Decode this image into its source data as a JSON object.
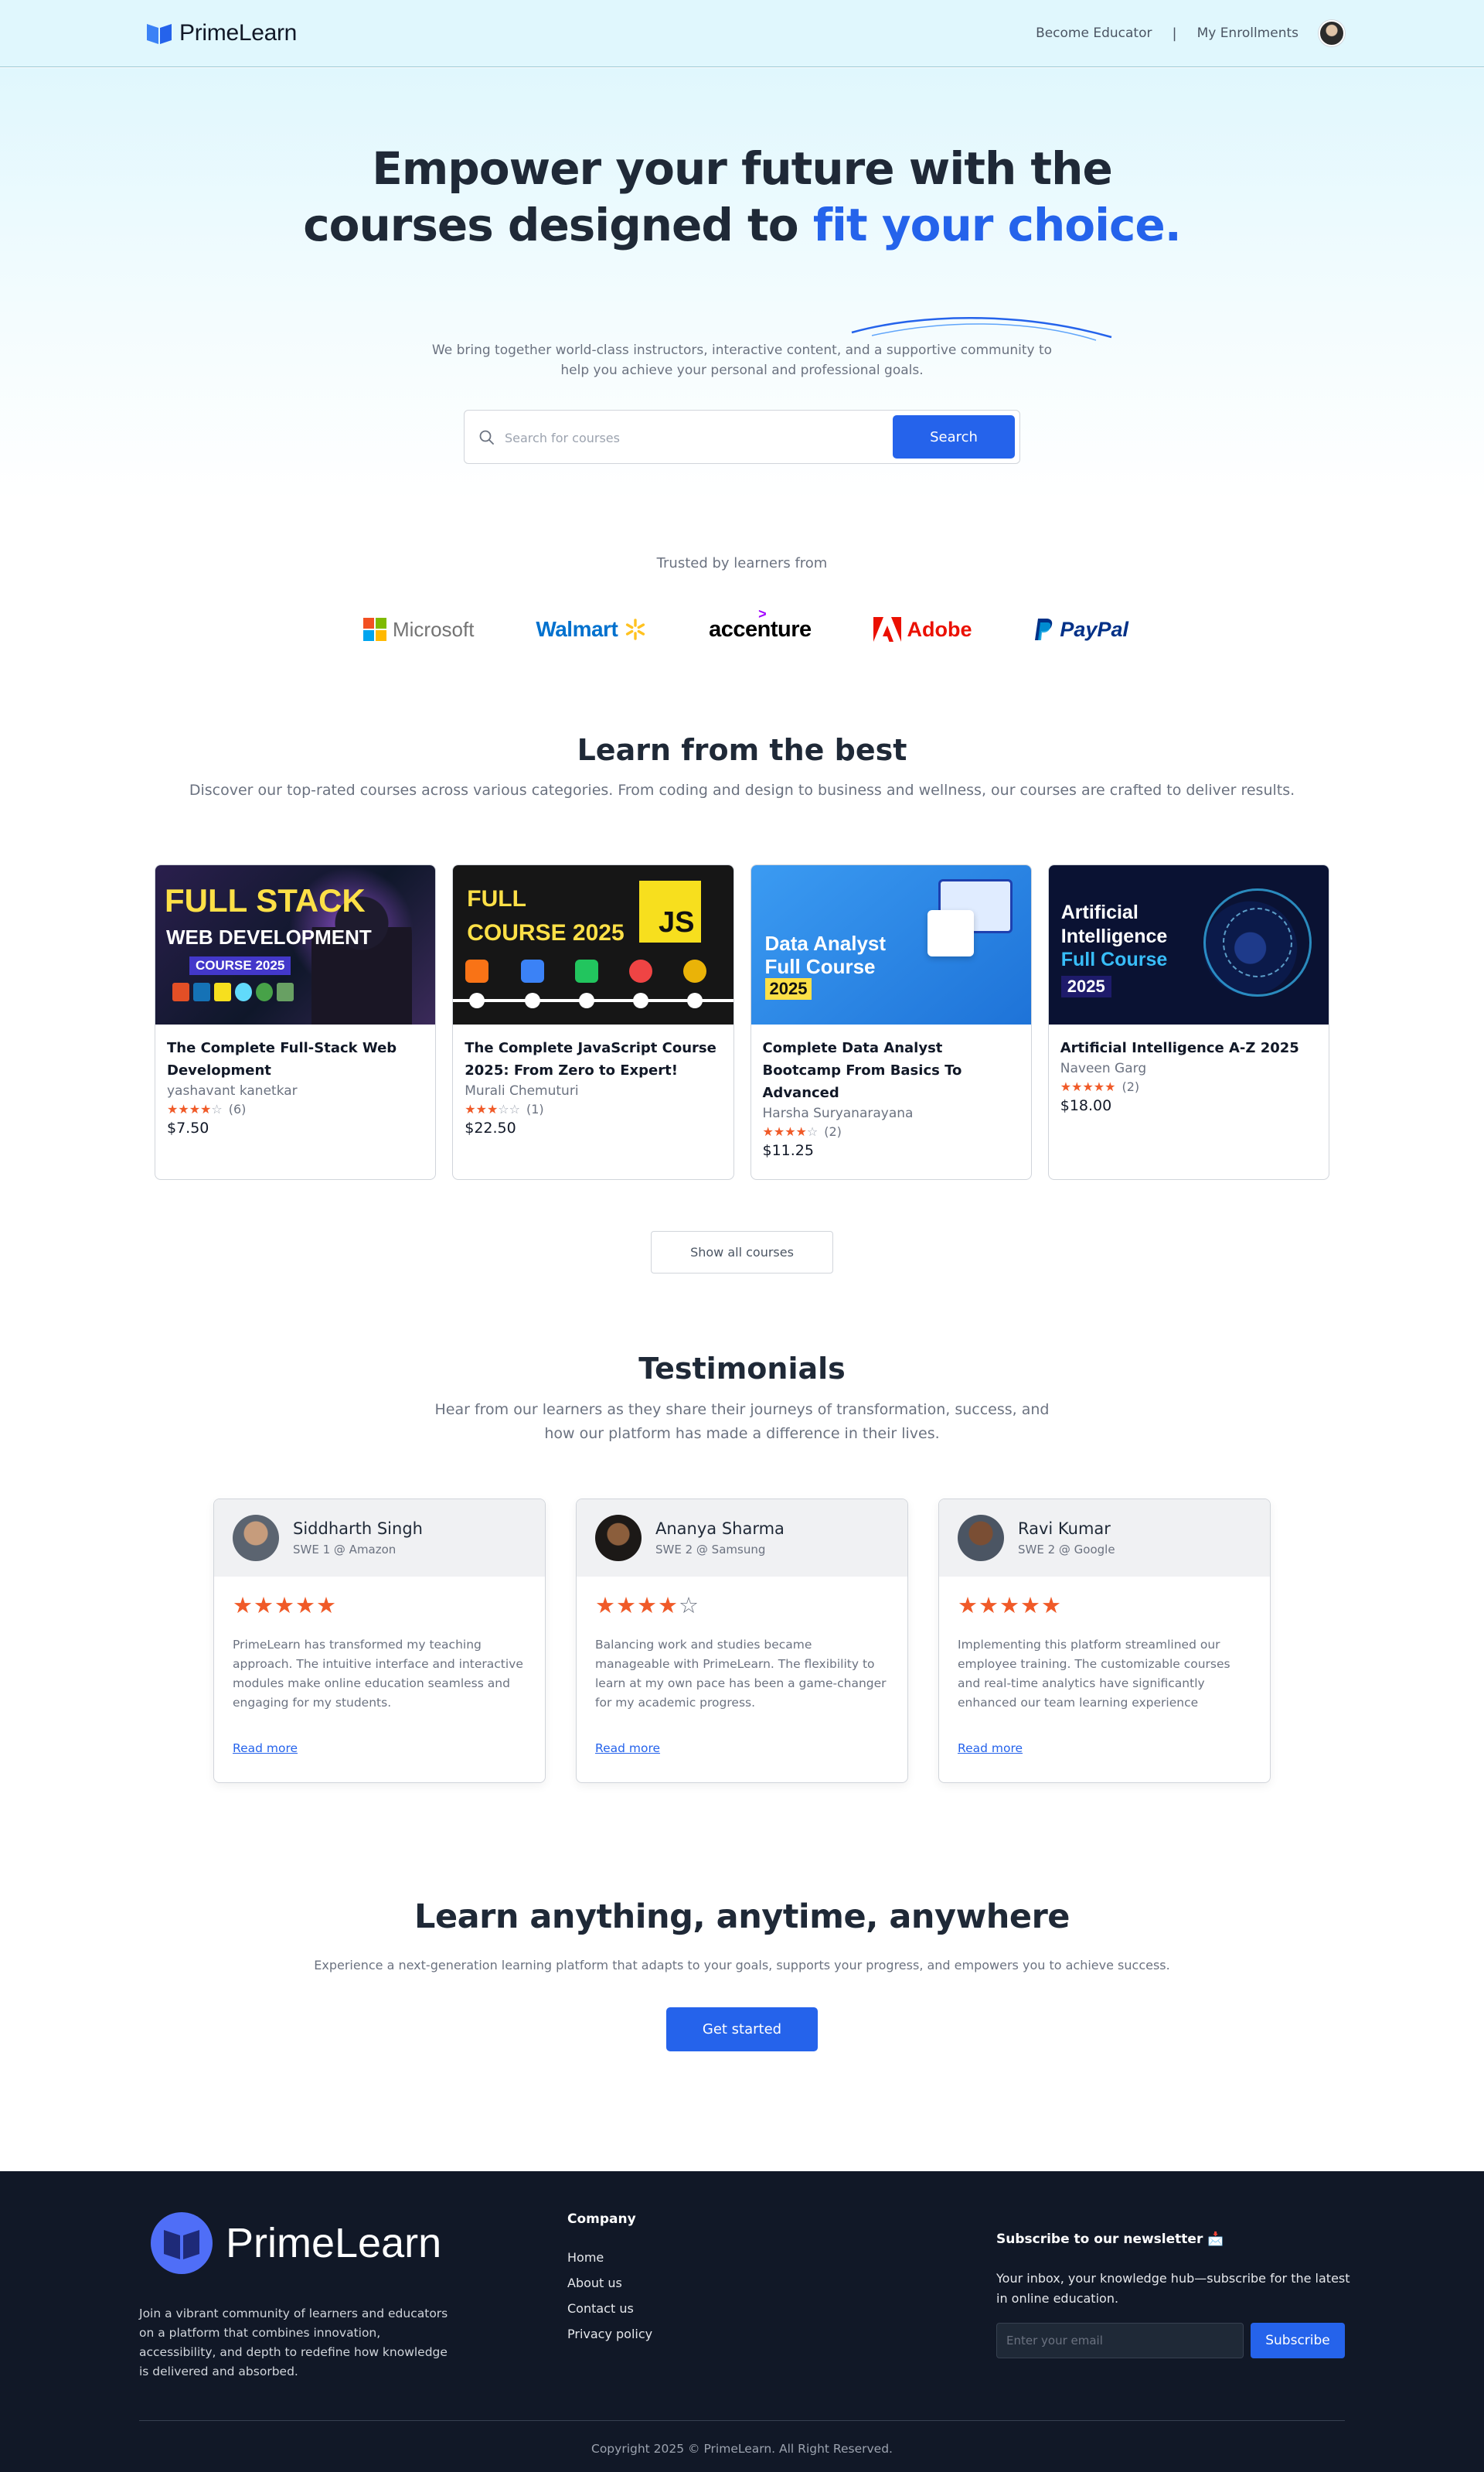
{
  "nav": {
    "brand": "PrimeLearn",
    "become_educator": "Become Educator",
    "separator": "|",
    "my_enrollments": "My Enrollments"
  },
  "hero": {
    "title_line1": "Empower your future with the",
    "title_line2_plain": "courses designed to ",
    "title_line2_accent": "fit your choice.",
    "subtitle": "We bring together world-class instructors, interactive content, and a supportive community to help you achieve your personal and professional goals.",
    "search_placeholder": "Search for courses",
    "search_button": "Search"
  },
  "trusted": {
    "label": "Trusted by learners from",
    "logos": [
      "Microsoft",
      "Walmart",
      "accenture",
      "Adobe",
      "PayPal"
    ]
  },
  "courses_section": {
    "title": "Learn from the best",
    "subtitle": "Discover our top-rated courses across various categories. From coding and design to business and wellness, our courses are crafted to deliver results.",
    "show_all": "Show all courses",
    "courses": [
      {
        "thumb_lines": [
          "FULL STACK",
          "WEB DEVELOPMENT",
          "COURSE 2025"
        ],
        "title": "The Complete Full-Stack Web Development",
        "author": "yashavant kanetkar",
        "stars_filled": "★★★★",
        "stars_empty": "☆",
        "rating": 4,
        "count": "(6)",
        "price": "$7.50"
      },
      {
        "thumb_lines": [
          "FULL",
          "COURSE 2025",
          "JS"
        ],
        "title": "The Complete JavaScript Course 2025: From Zero to Expert!",
        "author": "Murali Chemuturi",
        "stars_filled": "★★★",
        "stars_empty": "☆☆",
        "rating": 3,
        "count": "(1)",
        "price": "$22.50"
      },
      {
        "thumb_lines": [
          "Data Analyst",
          "Full Course",
          "2025"
        ],
        "title": "Complete Data Analyst Bootcamp From Basics To Advanced",
        "author": "Harsha Suryanarayana",
        "stars_filled": "★★★★",
        "stars_empty": "☆",
        "rating": 4,
        "count": "(2)",
        "price": "$11.25"
      },
      {
        "thumb_lines": [
          "Artificial",
          "Intelligence",
          "Full Course",
          "2025"
        ],
        "title": "Artificial Intelligence A-Z 2025",
        "author": "Naveen Garg",
        "stars_filled": "★★★★★",
        "stars_empty": "",
        "rating": 5,
        "count": "(2)",
        "price": "$18.00"
      }
    ]
  },
  "testimonials": {
    "title": "Testimonials",
    "subtitle": "Hear from our learners as they share their journeys of transformation, success, and how our platform has made a difference in their lives.",
    "items": [
      {
        "name": "Siddharth Singh",
        "role": "SWE 1 @ Amazon",
        "stars_filled": "★★★★★",
        "stars_empty": "",
        "rating": 5,
        "quote": "PrimeLearn has transformed my teaching approach. The intuitive interface and interactive modules make online education seamless and engaging for my students.",
        "read_more": "Read more"
      },
      {
        "name": "Ananya Sharma",
        "role": "SWE 2 @ Samsung",
        "stars_filled": "★★★★",
        "stars_empty": "☆",
        "rating": 4,
        "quote": "Balancing work and studies became manageable with PrimeLearn. The flexibility to learn at my own pace has been a game-changer for my academic progress.",
        "read_more": "Read more"
      },
      {
        "name": "Ravi Kumar",
        "role": "SWE 2 @ Google",
        "stars_filled": "★★★★★",
        "stars_empty": "",
        "rating": 5,
        "quote": "Implementing this platform streamlined our employee training. The customizable courses and real-time analytics have significantly enhanced our team learning experience",
        "read_more": "Read more"
      }
    ]
  },
  "cta": {
    "title": "Learn anything, anytime, anywhere",
    "subtitle": "Experience a next-generation learning platform that adapts to your goals, supports your progress, and empowers you to achieve success.",
    "button": "Get started"
  },
  "footer": {
    "brand": "PrimeLearn",
    "description": "Join a vibrant community of learners and educators on a platform that combines innovation, accessibility, and depth to redefine how knowledge is delivered and absorbed.",
    "company_title": "Company",
    "links": [
      "Home",
      "About us",
      "Contact us",
      "Privacy policy"
    ],
    "newsletter_title": "Subscribe to our newsletter 📩",
    "newsletter_desc": "Your inbox, your knowledge hub—subscribe for the latest in online education.",
    "email_placeholder": "Enter your email",
    "subscribe_button": "Subscribe",
    "copyright": "Copyright 2025 © PrimeLearn. All Right Reserved."
  },
  "colors": {
    "accent": "#2563eb",
    "star": "#f05a28",
    "nav_bg": "#e0f7fd",
    "footer_bg": "#111827"
  }
}
